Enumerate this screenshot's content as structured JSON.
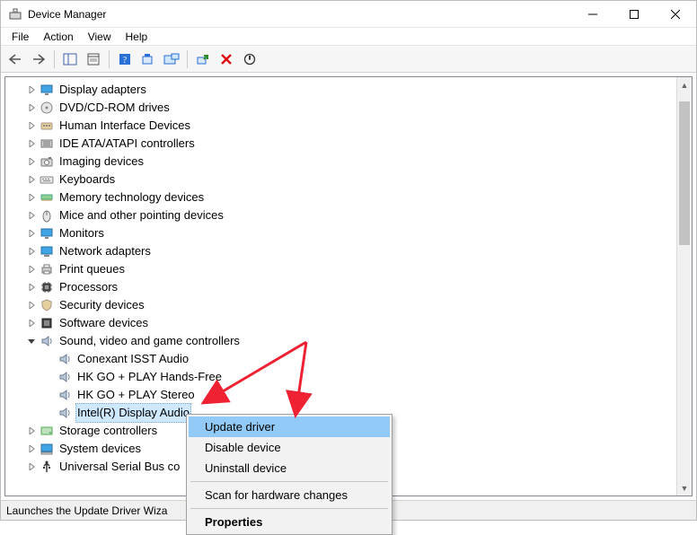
{
  "window": {
    "title": "Device Manager"
  },
  "menu": {
    "file": "File",
    "action": "Action",
    "view": "View",
    "help": "Help"
  },
  "tree": {
    "items": [
      {
        "label": "Display adapters",
        "icon": "monitor"
      },
      {
        "label": "DVD/CD-ROM drives",
        "icon": "disc"
      },
      {
        "label": "Human Interface Devices",
        "icon": "hid"
      },
      {
        "label": "IDE ATA/ATAPI controllers",
        "icon": "ide"
      },
      {
        "label": "Imaging devices",
        "icon": "camera"
      },
      {
        "label": "Keyboards",
        "icon": "keyboard"
      },
      {
        "label": "Memory technology devices",
        "icon": "memory"
      },
      {
        "label": "Mice and other pointing devices",
        "icon": "mouse"
      },
      {
        "label": "Monitors",
        "icon": "monitor"
      },
      {
        "label": "Network adapters",
        "icon": "network"
      },
      {
        "label": "Print queues",
        "icon": "printer"
      },
      {
        "label": "Processors",
        "icon": "cpu"
      },
      {
        "label": "Security devices",
        "icon": "shield"
      },
      {
        "label": "Software devices",
        "icon": "software"
      }
    ],
    "expanded": {
      "label": "Sound, video and game controllers",
      "icon": "speaker",
      "children": [
        {
          "label": "Conexant ISST Audio"
        },
        {
          "label": "HK GO + PLAY Hands-Free"
        },
        {
          "label": "HK GO + PLAY Stereo"
        },
        {
          "label": "Intel(R) Display Audio",
          "selected": true
        }
      ]
    },
    "after": [
      {
        "label": "Storage controllers",
        "icon": "storage"
      },
      {
        "label": "System devices",
        "icon": "system"
      },
      {
        "label": "Universal Serial Bus co",
        "icon": "usb"
      }
    ]
  },
  "context_menu": {
    "update": "Update driver",
    "disable": "Disable device",
    "uninstall": "Uninstall device",
    "scan": "Scan for hardware changes",
    "properties": "Properties"
  },
  "statusbar": {
    "text": "Launches the Update Driver Wiza"
  }
}
